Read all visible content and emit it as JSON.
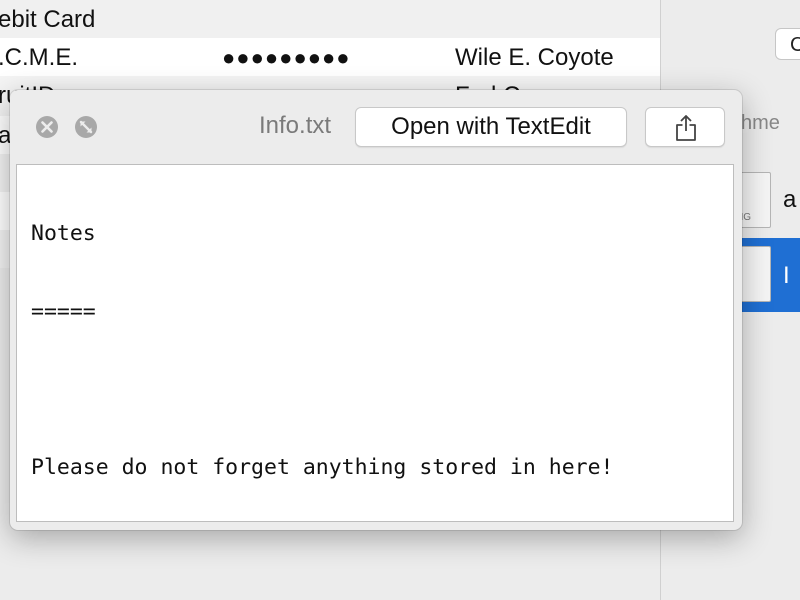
{
  "background_window": {
    "rows": [
      {
        "col1": "ebit Card",
        "col2": "",
        "col3": ""
      },
      {
        "col1": ".C.M.E.",
        "col2": "●●●●●●●●●",
        "col3": "Wile E. Coyote"
      },
      {
        "col1": "ruitID",
        "col2": "",
        "col3": "Fad C"
      },
      {
        "col1": "a",
        "col2": "",
        "col3": ""
      }
    ],
    "right_panel": {
      "button_label": "C",
      "attachments_label": "chme",
      "files": [
        {
          "icon_tag": "NG",
          "name": "a"
        },
        {
          "icon_tag": "",
          "name": "I"
        }
      ]
    }
  },
  "quicklook": {
    "filename": "Info.txt",
    "open_button_label": "Open with TextEdit",
    "icons": {
      "close": "close-circle-icon",
      "fullscreen": "fullscreen-icon",
      "share": "share-icon"
    },
    "content_lines": [
      "Notes",
      "=====",
      "",
      "Please do not forget anything stored in here!"
    ]
  },
  "colors": {
    "selection_blue": "#1f6fd3",
    "panel_bg": "#ececec",
    "control_gray": "#a8a8a8"
  }
}
